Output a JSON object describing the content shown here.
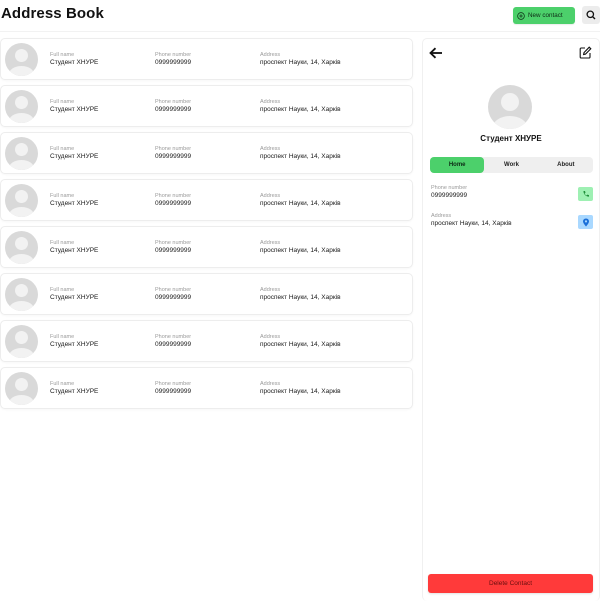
{
  "header": {
    "title": "Address Book",
    "new_contact_label": "New contact",
    "new_contact_icon": "plus-circle-icon",
    "search_icon": "search-icon"
  },
  "colors": {
    "accent_green": "#4cd06b",
    "delete_red": "#ff3a3a",
    "phone_button_bg": "#9ef0b3",
    "address_button_bg": "#a9d8ff"
  },
  "contacts": [
    {
      "full_name_label": "Full name",
      "full_name": "Студент ХНУРЕ",
      "phone_label": "Phone number",
      "phone": "0999999999",
      "address_label": "Address",
      "address": "проспект Науки, 14, Харків"
    },
    {
      "full_name_label": "Full name",
      "full_name": "Студент ХНУРЕ",
      "phone_label": "Phone number",
      "phone": "0999999999",
      "address_label": "Address",
      "address": "проспект Науки, 14, Харків"
    },
    {
      "full_name_label": "Full name",
      "full_name": "Студент ХНУРЕ",
      "phone_label": "Phone number",
      "phone": "0999999999",
      "address_label": "Address",
      "address": "проспект Науки, 14, Харків"
    },
    {
      "full_name_label": "Full name",
      "full_name": "Студент ХНУРЕ",
      "phone_label": "Phone number",
      "phone": "0999999999",
      "address_label": "Address",
      "address": "проспект Науки, 14, Харків"
    },
    {
      "full_name_label": "Full name",
      "full_name": "Студент ХНУРЕ",
      "phone_label": "Phone number",
      "phone": "0999999999",
      "address_label": "Address",
      "address": "проспект Науки, 14, Харків"
    },
    {
      "full_name_label": "Full name",
      "full_name": "Студент ХНУРЕ",
      "phone_label": "Phone number",
      "phone": "0999999999",
      "address_label": "Address",
      "address": "проспект Науки, 14, Харків"
    },
    {
      "full_name_label": "Full name",
      "full_name": "Студент ХНУРЕ",
      "phone_label": "Phone number",
      "phone": "0999999999",
      "address_label": "Address",
      "address": "проспект Науки, 14, Харків"
    },
    {
      "full_name_label": "Full name",
      "full_name": "Студент ХНУРЕ",
      "phone_label": "Phone number",
      "phone": "0999999999",
      "address_label": "Address",
      "address": "проспект Науки, 14, Харків"
    }
  ],
  "detail": {
    "name": "Студент ХНУРЕ",
    "tabs": [
      {
        "label": "Home",
        "active": true
      },
      {
        "label": "Work",
        "active": false
      },
      {
        "label": "About",
        "active": false
      }
    ],
    "phone_label": "Phone number",
    "phone": "0999999999",
    "address_label": "Address",
    "address": "проспект Науки, 14, Харків",
    "delete_label": "Delete Contact"
  }
}
